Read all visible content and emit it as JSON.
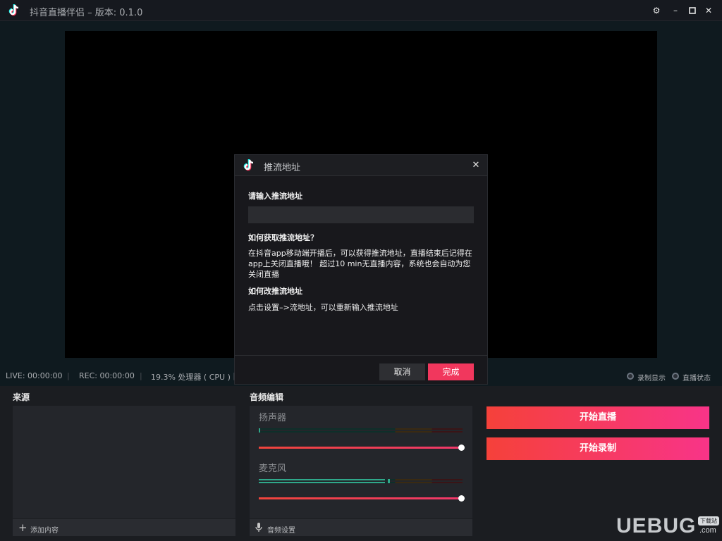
{
  "window": {
    "title": "抖音直播伴侣 – 版本: 0.1.0",
    "icons": {
      "settings": "gear-icon",
      "minimize": "minimize-icon",
      "maximize": "maximize-icon",
      "close": "close-icon"
    }
  },
  "dialog": {
    "title": "推流地址",
    "input_label": "请输入推流地址",
    "input_value": "",
    "q1": "如何获取推流地址？",
    "a1": "在抖音app移动端开播后，可以获得推流地址，直播结束后记得在app上关闭直播哦！ 超过10 min无直播内容，系统也会自动为您关闭直播",
    "q2": "如何改推流地址",
    "a2": "点击设置–>流地址，可以重新输入推流地址",
    "cancel_label": "取消",
    "ok_label": "完成"
  },
  "status": {
    "live": "LIVE: 00:00:00",
    "rec": "REC: 00:00:00",
    "cpu": "19.3% 处理器 ( CPU )",
    "separator": "|",
    "record_display": "录制显示",
    "live_status": "直播状态"
  },
  "sources": {
    "title": "来源",
    "add_label": "添加内容"
  },
  "audio": {
    "title": "音频编辑",
    "speaker_label": "扬声器",
    "mic_label": "麦克风",
    "settings_label": "音频设置",
    "speaker_volume": 1.0,
    "mic_volume": 1.0,
    "mic_level": 0.62
  },
  "actions": {
    "start_live": "开始直播",
    "start_record": "开始录制"
  },
  "watermark": {
    "text": "UEBUG",
    "sub": "下载站",
    "domain": ".com"
  },
  "colors": {
    "accent": "#f1375d",
    "accent_gradient_start": "#f5413a",
    "accent_gradient_end": "#f83488"
  }
}
